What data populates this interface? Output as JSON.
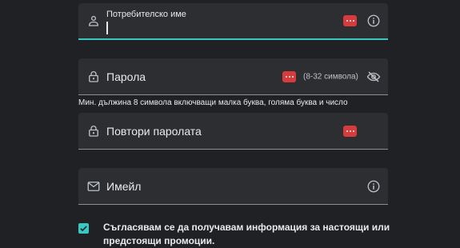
{
  "colors": {
    "background": "#202124",
    "field_bg": "#2c2e32",
    "accent": "#38c7c2",
    "password_manager": "#d83b3b",
    "text": "#e8eaed"
  },
  "fields": {
    "username": {
      "label": "Потребителско име",
      "icon": "person-icon",
      "trail_icon": "info-icon"
    },
    "password": {
      "label": "Парола",
      "hint": "(8-32 символа)",
      "icon": "lock-icon",
      "trail_icon": "visibility-off-icon",
      "helper": "Мин. дължина 8 символа включващи малка буква, голяма буква и число"
    },
    "password_repeat": {
      "label": "Повтори паролата",
      "icon": "lock-icon"
    },
    "email": {
      "label": "Имейл",
      "icon": "mail-icon",
      "trail_icon": "info-icon"
    }
  },
  "consent": {
    "checked": true,
    "text": "Съгласявам се да получавам информация за настоящи или предстоящи промоции."
  }
}
